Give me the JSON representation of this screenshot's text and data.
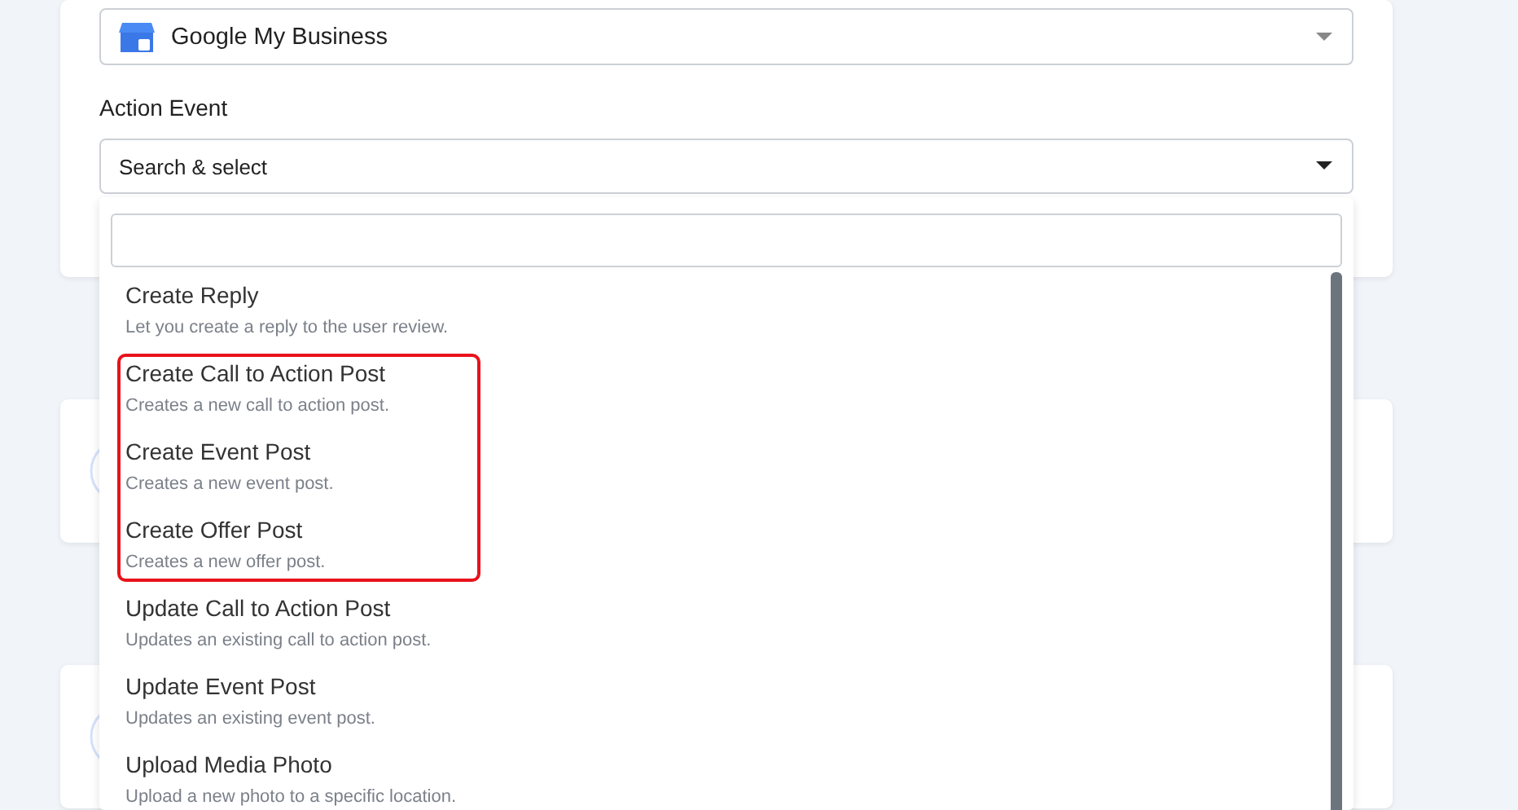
{
  "app_field": {
    "value": "Google My Business"
  },
  "action_event": {
    "label": "Action Event",
    "placeholder": "Search & select",
    "expanded": true
  },
  "dropdown": {
    "options": [
      {
        "title": "Create Reply",
        "description": "Let you create a reply to the user review.",
        "highlighted": false
      },
      {
        "title": "Create Call to Action Post",
        "description": "Creates a new call to action post.",
        "highlighted": true
      },
      {
        "title": "Create Event Post",
        "description": "Creates a new event post.",
        "highlighted": true
      },
      {
        "title": "Create Offer Post",
        "description": "Creates a new offer post.",
        "highlighted": true
      },
      {
        "title": "Update Call to Action Post",
        "description": "Updates an existing call to action post.",
        "highlighted": false
      },
      {
        "title": "Update Event Post",
        "description": "Updates an existing event post.",
        "highlighted": false
      },
      {
        "title": "Upload Media Photo",
        "description": "Upload a new photo to a specific location.",
        "highlighted": false
      }
    ]
  }
}
